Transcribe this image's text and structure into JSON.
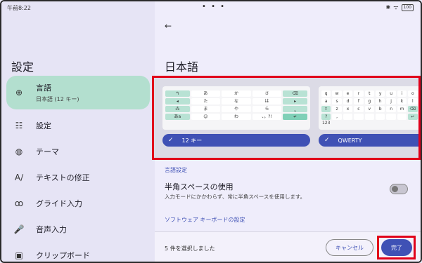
{
  "status": {
    "time": "午前8:22",
    "dots": "• • •",
    "bluetooth": "✱",
    "wifi": "ᯤ",
    "battery": "100"
  },
  "left": {
    "title": "設定",
    "items": [
      {
        "label": "言語",
        "sub": "日本語 (12 キー)",
        "icon": "globe-icon",
        "glyph": "⊕"
      },
      {
        "label": "設定",
        "icon": "tune-icon",
        "glyph": "☷"
      },
      {
        "label": "テーマ",
        "icon": "palette-icon",
        "glyph": "◍"
      },
      {
        "label": "テキストの修正",
        "icon": "spellcheck-icon",
        "glyph": "A∕"
      },
      {
        "label": "グライド入力",
        "icon": "gesture-icon",
        "glyph": "ꝏ"
      },
      {
        "label": "音声入力",
        "icon": "mic-icon",
        "glyph": "🎤"
      },
      {
        "label": "クリップボード",
        "icon": "clipboard-icon",
        "glyph": "▣"
      }
    ]
  },
  "right": {
    "back_glyph": "←",
    "title": "日本語",
    "layouts": [
      {
        "name": "12 キー",
        "checked": true
      },
      {
        "name": "QWERTY",
        "checked": true
      }
    ],
    "kb12_keys": [
      "↰",
      "あ",
      "か",
      "さ",
      "⌫",
      "◂",
      "た",
      "な",
      "は",
      "▸",
      "⁂",
      "ま",
      "や",
      "ら",
      "⎵",
      "あa",
      "☺",
      "わ",
      "、。?!",
      "↵"
    ],
    "qwerty_rows": [
      [
        "q",
        "w",
        "e",
        "r",
        "t",
        "y",
        "u",
        "i",
        "o",
        "p"
      ],
      [
        "a",
        "s",
        "d",
        "f",
        "g",
        "h",
        "j",
        "k",
        "l"
      ],
      [
        "⇧",
        "z",
        "x",
        "c",
        "v",
        "b",
        "n",
        "m",
        "⌫"
      ],
      [
        "?123",
        ",",
        "",
        "",
        "",
        "",
        "",
        "",
        "↵"
      ]
    ],
    "section_language": "言語設定",
    "pref_title": "半角スペースの使用",
    "pref_sub": "入力モードにかかわらず、常に半角スペースを使用します。",
    "section_software": "ソフトウェア キーボードの設定",
    "faded_text": "…………………………………",
    "selected_count": "5 件を選択しました",
    "cancel": "キャンセル",
    "done": "完了",
    "colors": {
      "accent": "#3f51b5",
      "highlight": "#e1001a",
      "active_nav": "#b3dfcf"
    }
  }
}
